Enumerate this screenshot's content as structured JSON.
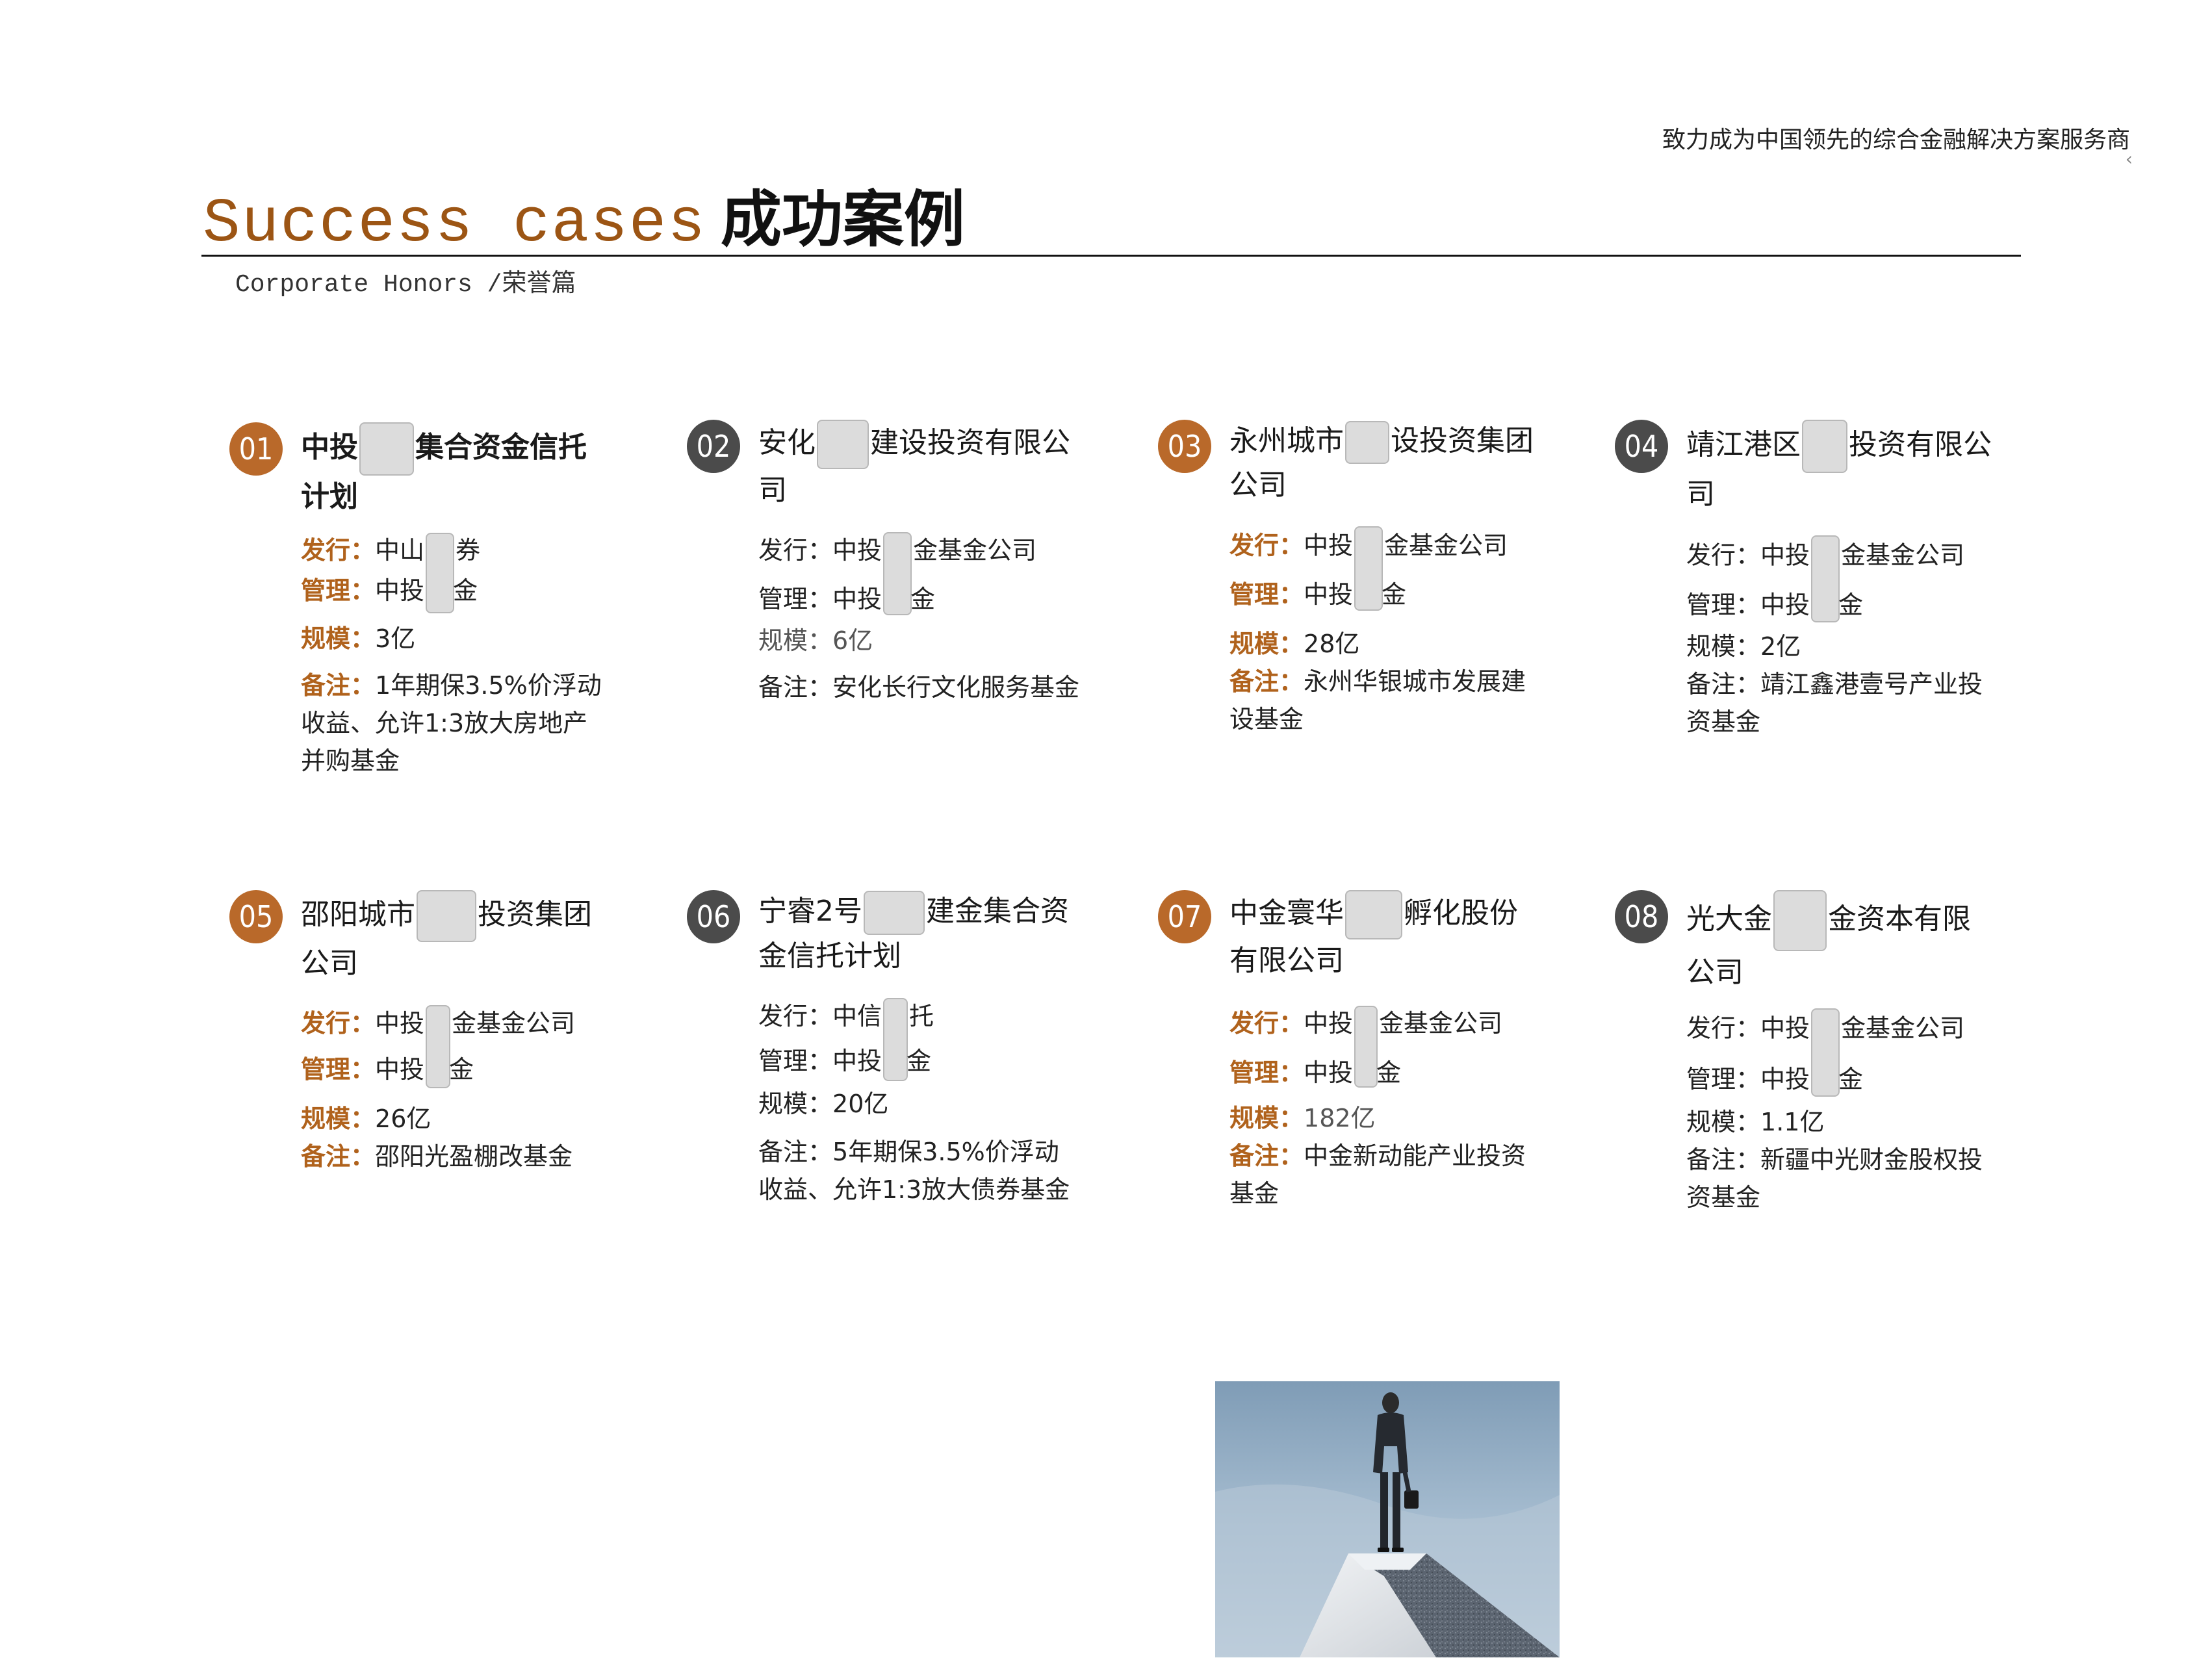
{
  "header": {
    "tagline": "致力成为中国领先的综合金融解决方案服务商",
    "chevron": "‹",
    "title_en": "Success  cases",
    "title_cn": "成功案例",
    "subtitle_en": "Corporate Honors /",
    "subtitle_cn": "荣誉篇"
  },
  "labels": {
    "issue": "发行：",
    "manage": "管理：",
    "scale": "规模：",
    "note": "备注："
  },
  "cases": [
    {
      "num": "01",
      "name_a": "中投",
      "name_b": "集合资金信托计划",
      "issue_a": "中山",
      "issue_b": "券",
      "manage_a": "中投",
      "manage_b": "金",
      "scale": "3亿",
      "note": "1年期保3.5%价浮动收益、允许1:3放大房地产并购基金"
    },
    {
      "num": "02",
      "name_a": "安化",
      "name_b": "建设投资有限公司",
      "issue_a": "中投",
      "issue_b": "金基金公司",
      "manage_a": "中投",
      "manage_b": "金",
      "scale": "6亿",
      "note": "安化长行文化服务基金"
    },
    {
      "num": "03",
      "name_a": "永州城市",
      "name_b": "设投资集团公司",
      "issue_a": "中投",
      "issue_b": "金基金公司",
      "manage_a": "中投",
      "manage_b": "金",
      "scale": "28亿",
      "note": "永州华银城市发展建设基金"
    },
    {
      "num": "04",
      "name_a": "靖江港区",
      "name_b": "投资有限公司",
      "issue_a": "中投",
      "issue_b": "金基金公司",
      "manage_a": "中投",
      "manage_b": "金",
      "scale": "2亿",
      "note": "靖江鑫港壹号产业投资基金"
    },
    {
      "num": "05",
      "name_a": "邵阳城市",
      "name_b": "投资集团公司",
      "issue_a": "中投",
      "issue_b": "金基金公司",
      "manage_a": "中投",
      "manage_b": "金",
      "scale": "26亿",
      "note": "邵阳光盈棚改基金"
    },
    {
      "num": "06",
      "name_a": "宁睿2号",
      "name_b": "建金集合资金信托计划",
      "issue_a": "中信",
      "issue_b": "托",
      "manage_a": "中投",
      "manage_b": "金",
      "scale": "20亿",
      "note": "5年期保3.5%价浮动收益、允许1:3放大债券基金"
    },
    {
      "num": "07",
      "name_a": "中金寰华",
      "name_b": "孵化股份有限公司",
      "issue_a": "中投",
      "issue_b": "金基金公司",
      "manage_a": "中投",
      "manage_b": "金",
      "scale": "182亿",
      "note": "中金新动能产业投资基金"
    },
    {
      "num": "08",
      "name_a": "光大金",
      "name_b": "金资本有限公司",
      "issue_a": "中投",
      "issue_b": "金基金公司",
      "manage_a": "中投",
      "manage_b": "金",
      "scale": "1.1亿",
      "note": "新疆中光财金股权投资基金"
    }
  ],
  "colors": {
    "accent": "#b0621c",
    "badge_orange": "#b9692a",
    "badge_gray": "#4b4b4b",
    "title_en": "#9c5514"
  }
}
